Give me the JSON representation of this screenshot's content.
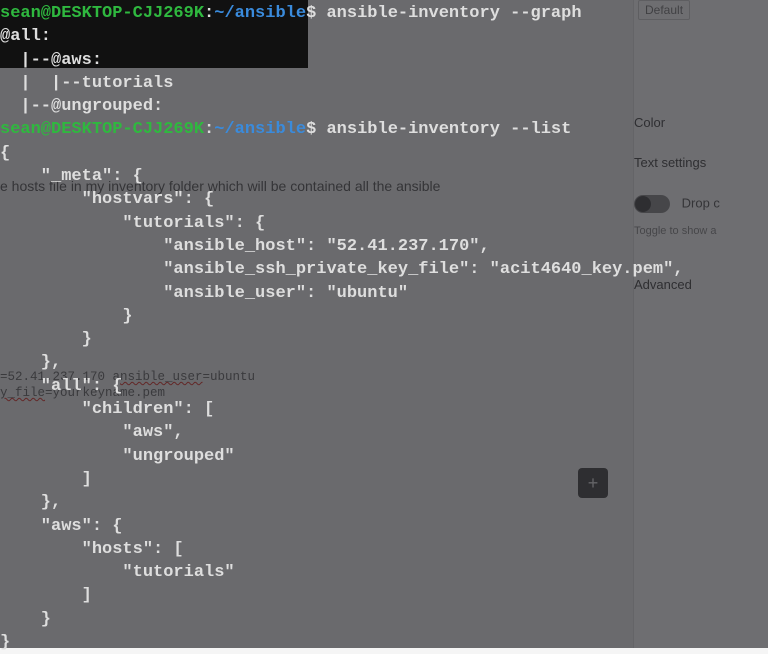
{
  "background": {
    "mainText": "e hosts file in my inventory folder which will be contained all the ansible",
    "codeLine1_pre": "=52.41.237.170 a",
    "codeLine1_under": "nsible_user",
    "codeLine1_post": "=ubuntu",
    "codeLine2_under": "y_file",
    "codeLine2_post": "=yourkeyname.pem",
    "rightPanel": {
      "dropdown": "Default",
      "color": "Color",
      "textSettings": "Text settings",
      "dropCap": "Drop c",
      "helpText": "Toggle to show a",
      "advanced": "Advanced"
    },
    "addButton": "+"
  },
  "terminal": {
    "prompt_user": "sean@DESKTOP-CJJ269K",
    "prompt_colon": ":",
    "prompt_path": "~/ansible",
    "prompt_dollar": "$ ",
    "cmd1": "ansible-inventory --graph",
    "graph_l1": "@all:",
    "graph_l2": "  |--@aws:",
    "graph_l3": "  |  |--tutorials",
    "graph_l4": "  |--@ungrouped:",
    "cmd2": "ansible-inventory --list",
    "json_l1": "{",
    "json_l2": "    \"_meta\": {",
    "json_l3": "        \"hostvars\": {",
    "json_l4": "            \"tutorials\": {",
    "json_l5": "                \"ansible_host\": \"52.41.237.170\",",
    "json_l6": "                \"ansible_ssh_private_key_file\": \"acit4640_key.pem\",",
    "json_l7": "                \"ansible_user\": \"ubuntu\"",
    "json_l8": "            }",
    "json_l9": "        }",
    "json_l10": "    },",
    "json_l11": "    \"all\": {",
    "json_l12": "        \"children\": [",
    "json_l13": "            \"aws\",",
    "json_l14": "            \"ungrouped\"",
    "json_l15": "        ]",
    "json_l16": "    },",
    "json_l17": "    \"aws\": {",
    "json_l18": "        \"hosts\": [",
    "json_l19": "            \"tutorials\"",
    "json_l20": "        ]",
    "json_l21": "    }",
    "json_l22": "}"
  }
}
